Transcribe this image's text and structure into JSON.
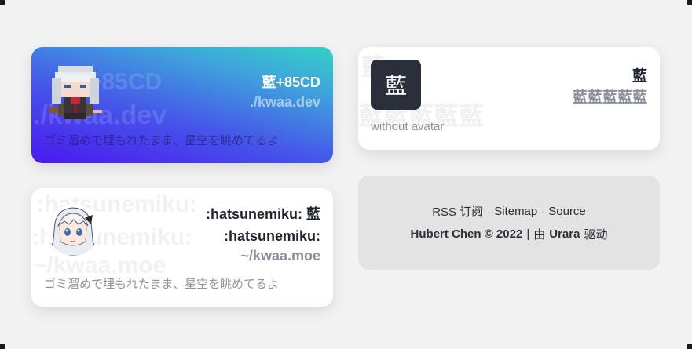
{
  "cards": [
    {
      "title": "藍+85CD",
      "link": "./kwaa.dev",
      "bio": "ゴミ溜めで埋もれたまま、星空を眺めてるよ",
      "watermark": [
        "藍+85CD",
        "./kwaa.dev"
      ],
      "avatar_icon": "pixel-art-avatar"
    },
    {
      "title": "藍",
      "link": "藍藍藍藍藍",
      "bio": "without avatar",
      "avatar_letter": "藍",
      "watermark": [
        "藍",
        "藍藍藍藍藍"
      ]
    },
    {
      "title": ":hatsunemiku: 藍 :hatsunemiku:",
      "link": "~/kwaa.moe",
      "bio": "ゴミ溜めで埋もれたまま、星空を眺めてるよ",
      "watermark": [
        ":hatsunemiku:",
        ":hatsunemiku:",
        "~/kwaa.moe"
      ],
      "avatar_icon": "anime-avatar"
    }
  ],
  "footer": {
    "rss": "RSS 订阅",
    "sitemap": "Sitemap",
    "source": "Source",
    "separator": "·",
    "author": "Hubert Chen © 2022",
    "divider": "|",
    "powered_prefix": "由",
    "powered_name": "Urara",
    "powered_suffix": "驱动"
  },
  "colors": {
    "gradient_start": "#4a18f0",
    "gradient_end": "#33d1c6",
    "card_bg": "#ffffff",
    "footer_bg": "#e3e3e3",
    "page_bg": "#f2f2f2"
  }
}
